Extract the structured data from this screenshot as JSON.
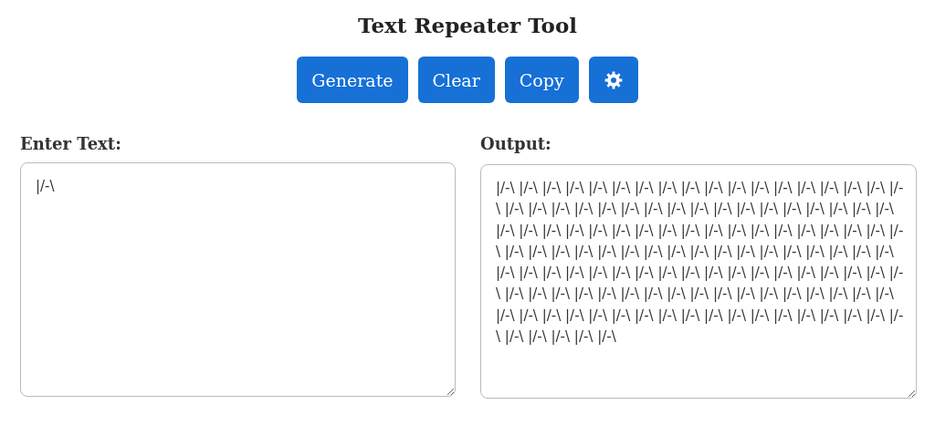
{
  "title": "Text Repeater Tool",
  "buttons": [
    {
      "kind": "text",
      "label": "Generate"
    },
    {
      "kind": "text",
      "label": "Clear"
    },
    {
      "kind": "text",
      "label": "Copy"
    },
    {
      "kind": "settings"
    }
  ],
  "input": {
    "label": "Enter Text:",
    "value": "|/-\\"
  },
  "output": {
    "label": "Output:",
    "value": "|/-\\ |/-\\ |/-\\ |/-\\ |/-\\ |/-\\ |/-\\ |/-\\ |/-\\ |/-\\ |/-\\ |/-\\ |/-\\ |/-\\ |/-\\ |/-\\ |/-\\ |/-\\ |/-\\ |/-\\ |/-\\ |/-\\ |/-\\ |/-\\ |/-\\ |/-\\ |/-\\ |/-\\ |/-\\ |/-\\ |/-\\ |/-\\ |/-\\ |/-\\ |/-\\ |/-\\ |/-\\ |/-\\ |/-\\ |/-\\ |/-\\ |/-\\ |/-\\ |/-\\ |/-\\ |/-\\ |/-\\ |/-\\ |/-\\ |/-\\ |/-\\ |/-\\ |/-\\ |/-\\ |/-\\ |/-\\ |/-\\ |/-\\ |/-\\ |/-\\ |/-\\ |/-\\ |/-\\ |/-\\ |/-\\ |/-\\ |/-\\ |/-\\ |/-\\ |/-\\ |/-\\ |/-\\ |/-\\ |/-\\ |/-\\ |/-\\ |/-\\ |/-\\ |/-\\ |/-\\ |/-\\ |/-\\ |/-\\ |/-\\ |/-\\ |/-\\ |/-\\ |/-\\ |/-\\ |/-\\ |/-\\ |/-\\ |/-\\ |/-\\ |/-\\ |/-\\ |/-\\ |/-\\ |/-\\ |/-\\ |/-\\ |/-\\ |/-\\ |/-\\ |/-\\ |/-\\ |/-\\ |/-\\ |/-\\ |/-\\ |/-\\ |/-\\ |/-\\ |/-\\ |/-\\ |/-\\ |/-\\ |/-\\ |/-\\ |/-\\ |/-\\ |/-\\ |/-\\ |/-\\ |/-\\ |/-\\ |/-\\ |/-\\"
  }
}
